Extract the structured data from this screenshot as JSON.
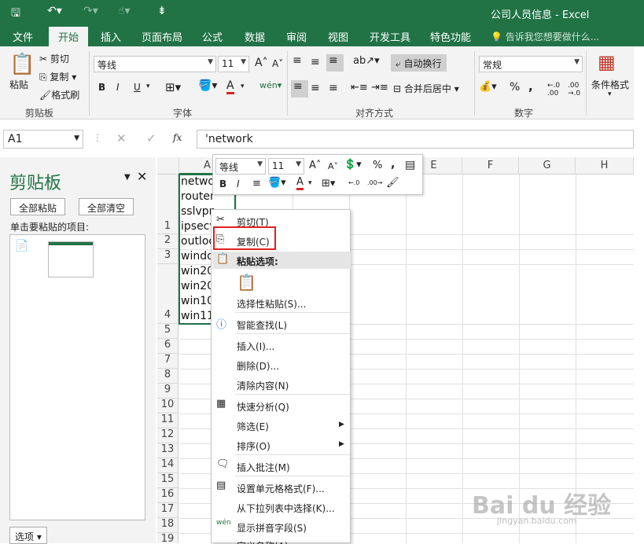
{
  "qat": {
    "save": "save-icon",
    "undo": "undo-icon",
    "redo": "redo-icon",
    "touch": "touch-icon",
    "custom": "customize-icon"
  },
  "window_title": "公司人员信息 - Excel",
  "tabs": [
    "文件",
    "开始",
    "插入",
    "页面布局",
    "公式",
    "数据",
    "审阅",
    "视图",
    "开发工具",
    "特色功能"
  ],
  "tell_me": "告诉我您想要做什么...",
  "ribbon": {
    "clipboard": {
      "paste": "粘贴",
      "cut": "剪切",
      "copy": "复制",
      "painter": "格式刷",
      "label": "剪贴板"
    },
    "font": {
      "name": "等线",
      "size": "11",
      "bold": "B",
      "italic": "I",
      "underline": "U",
      "font_color": "A",
      "grow": "A",
      "shrink": "A",
      "label": "字体"
    },
    "align": {
      "wrap": "自动换行",
      "merge": "合并后居中",
      "label": "对齐方式"
    },
    "number": {
      "format": "常规",
      "percent": "%",
      "comma": ",",
      "label": "数字"
    },
    "styles": {
      "cond": "条件格式"
    }
  },
  "formula_bar": {
    "name_box": "A1",
    "fx": "fx",
    "content": "'network"
  },
  "clipboard_pane": {
    "title": "剪贴板",
    "paste_all": "全部粘贴",
    "clear_all": "全部清空",
    "hint": "单击要粘贴的项目:",
    "options": "选项"
  },
  "columns": [
    "A",
    "B",
    "C",
    "D",
    "E",
    "F",
    "G",
    "H"
  ],
  "rows": [
    "1",
    "2",
    "3",
    "4",
    "5",
    "6",
    "7",
    "8",
    "9",
    "10",
    "11",
    "12",
    "13",
    "14",
    "15",
    "16",
    "17",
    "18",
    "19"
  ],
  "cells": [
    "netwo",
    "router",
    "sslvpn",
    "ipsecv",
    "outloo",
    "windo",
    "win20",
    "win20",
    "win10",
    "win11"
  ],
  "mini_toolbar": {
    "font": "等线",
    "size": "11",
    "bold": "B",
    "italic": "I",
    "font_color": "A",
    "percent": "%",
    "comma": ","
  },
  "context_menu": {
    "cut": "剪切(T)",
    "copy": "复制(C)",
    "paste_options": "粘贴选项:",
    "paste_special": "选择性粘贴(S)...",
    "smart_lookup": "智能查找(L)",
    "insert": "插入(I)...",
    "delete": "删除(D)...",
    "clear": "清除内容(N)",
    "quick_analysis": "快速分析(Q)",
    "filter": "筛选(E)",
    "sort": "排序(O)",
    "comment": "插入批注(M)",
    "format_cells": "设置单元格格式(F)...",
    "pick_list": "从下拉列表中选择(K)...",
    "phonetic": "显示拼音字段(S)",
    "define_name": "定义名称(A)..."
  },
  "highlight_color": "#e02020",
  "accent": "#217346",
  "watermark": {
    "text": "Bai du 经验",
    "url": "jingyan.baidu.com"
  }
}
